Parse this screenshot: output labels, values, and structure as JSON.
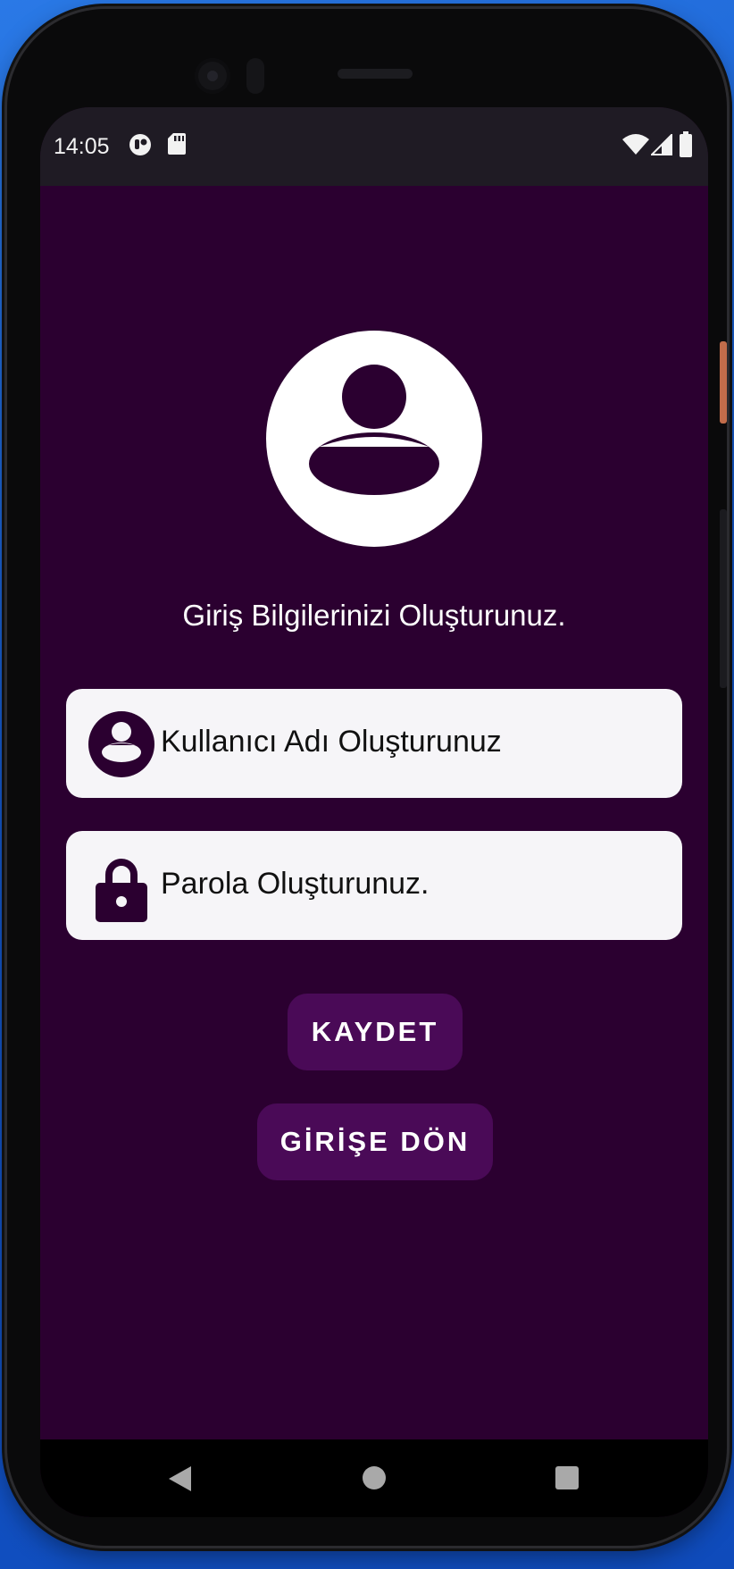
{
  "status_bar": {
    "time": "14:05",
    "icons": [
      "app-notification-icon",
      "sd-card-icon",
      "wifi-icon",
      "cell-signal-icon",
      "battery-icon"
    ]
  },
  "screen": {
    "avatar_icon": "account-circle-icon",
    "heading": "Giriş Bilgilerinizi Oluşturunuz.",
    "username_field": {
      "icon": "account-circle-icon",
      "placeholder": "Kullanıcı Adı Oluşturunuz"
    },
    "password_field": {
      "icon": "lock-icon",
      "placeholder": "Parola Oluşturunuz."
    },
    "save_button": "KAYDET",
    "back_to_login_button": "GİRİŞE DÖN"
  },
  "nav_bar": {
    "icons": [
      "back-icon",
      "home-icon",
      "recents-icon"
    ]
  },
  "colors": {
    "app_background": "#2b0030",
    "button_background": "#4a0a57",
    "field_background": "#f6f5f8",
    "icon_color": "#2b0030",
    "status_bar": "#1f1b24",
    "nav_bar": "#000000"
  }
}
